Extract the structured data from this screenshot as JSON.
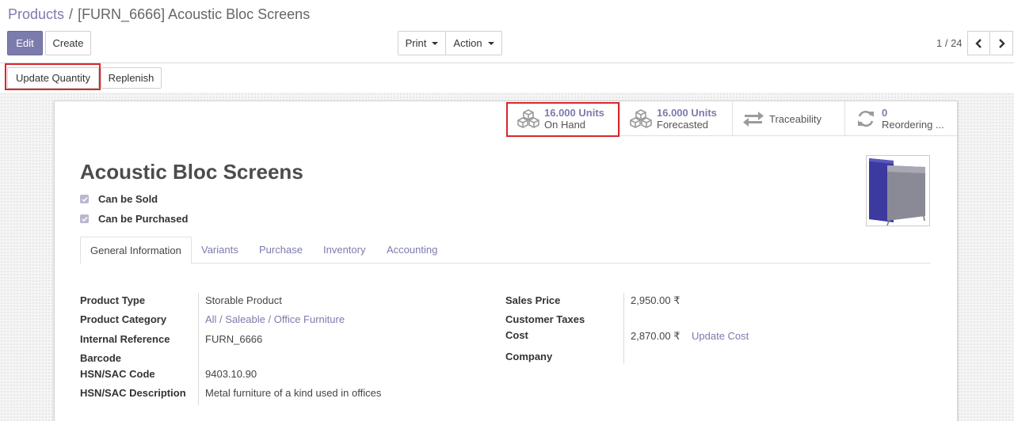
{
  "breadcrumb": {
    "parent": "Products",
    "separator": "/",
    "current": "[FURN_6666] Acoustic Bloc Screens"
  },
  "toolbar": {
    "edit_label": "Edit",
    "create_label": "Create",
    "print_label": "Print",
    "action_label": "Action"
  },
  "pager": {
    "value": "1 / 24"
  },
  "statusbar": {
    "update_quantity_label": "Update Quantity",
    "replenish_label": "Replenish"
  },
  "smart_buttons": [
    {
      "value": "16.000 Units",
      "label": "On Hand",
      "icon": "cubes-icon"
    },
    {
      "value": "16.000 Units",
      "label": "Forecasted",
      "icon": "cubes-icon"
    },
    {
      "value": "",
      "label": "Traceability",
      "icon": "exchange-icon"
    },
    {
      "value": "0",
      "label": "Reordering ...",
      "icon": "refresh-icon"
    }
  ],
  "product": {
    "name": "Acoustic Bloc Screens",
    "can_be_sold_label": "Can be Sold",
    "can_be_purchased_label": "Can be Purchased",
    "can_be_sold": true,
    "can_be_purchased": true
  },
  "tabs": [
    {
      "label": "General Information",
      "active": true
    },
    {
      "label": "Variants",
      "active": false
    },
    {
      "label": "Purchase",
      "active": false
    },
    {
      "label": "Inventory",
      "active": false
    },
    {
      "label": "Accounting",
      "active": false
    }
  ],
  "left_fields": {
    "product_type": {
      "label": "Product Type",
      "value": "Storable Product"
    },
    "product_category": {
      "label": "Product Category",
      "value": "All / Saleable / Office Furniture"
    },
    "internal_reference": {
      "label": "Internal Reference",
      "value": "FURN_6666"
    },
    "barcode": {
      "label": "Barcode",
      "value": ""
    },
    "hsn_code": {
      "label": "HSN/SAC Code",
      "value": "9403.10.90"
    },
    "hsn_description": {
      "label": "HSN/SAC Description",
      "value": "Metal furniture of a kind used in offices"
    }
  },
  "right_fields": {
    "sales_price": {
      "label": "Sales Price",
      "value": "2,950.00 ₹"
    },
    "customer_taxes": {
      "label": "Customer Taxes",
      "value": ""
    },
    "cost": {
      "label": "Cost",
      "value": "2,870.00 ₹",
      "action": "Update Cost"
    },
    "company": {
      "label": "Company",
      "value": ""
    }
  },
  "colors": {
    "primary": "#7c7bad",
    "highlight": "#d9262d"
  }
}
